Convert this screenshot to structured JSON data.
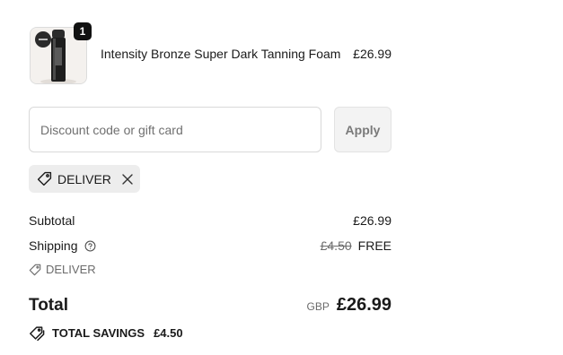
{
  "line_item": {
    "quantity": "1",
    "name": "Intensity Bronze Super Dark Tanning Foam",
    "price": "£26.99",
    "image": "tanning-foam-bottle-image"
  },
  "discount": {
    "placeholder": "Discount code or gift card",
    "value": "",
    "apply_label": "Apply",
    "applied_code": "DELIVER"
  },
  "summary": {
    "subtotal_label": "Subtotal",
    "subtotal_value": "£26.99",
    "shipping_label": "Shipping",
    "shipping_original": "£4.50",
    "shipping_value": "FREE",
    "shipping_discount_code": "DELIVER",
    "total_label": "Total",
    "currency": "GBP",
    "total_value": "£26.99",
    "savings_label": "TOTAL SAVINGS",
    "savings_value": "£4.50"
  },
  "icons": {
    "tag": "tag-icon",
    "close": "close-icon",
    "help": "question-circle-icon",
    "savings": "savings-tag-icon"
  },
  "colors": {
    "text": "#1a1a1a",
    "muted": "#6b6b6b",
    "chip_bg": "#ededed",
    "badge_bg": "#111111"
  }
}
